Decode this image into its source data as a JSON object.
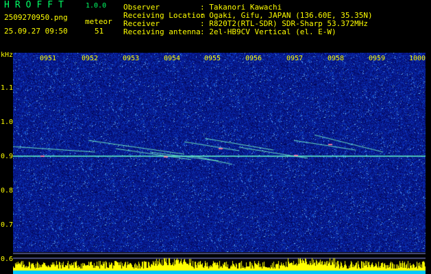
{
  "header": {
    "app_title": "HROFFT",
    "version": "1.0.0",
    "filename": "2509270950.png",
    "datetime": "25.09.27 09:50",
    "type_label": "meteor",
    "type_count": "51",
    "info": [
      {
        "key": "Observer",
        "value": ": Takanori Kawachi"
      },
      {
        "key": "Receiving Location",
        "value": ": Ogaki, Gifu, JAPAN (136.60E, 35.35N)"
      },
      {
        "key": "Receiver",
        "value": ": R820T2(RTL-SDR) SDR-Sharp 53.372MHz"
      },
      {
        "key": "Receiving antenna",
        "value": ": 2el-HB9CV Vertical (el. E-W)"
      }
    ]
  },
  "axes": {
    "y_unit": "kHz",
    "y_ticks": [
      "1.1",
      "1.0",
      "0.9",
      "0.8",
      "0.7",
      "0.6"
    ],
    "x_ticks": [
      "0951",
      "0952",
      "0953",
      "0954",
      "0955",
      "0956",
      "0957",
      "0958",
      "0959",
      "1000"
    ]
  },
  "colors": {
    "background": "#000000",
    "noise_floor": "#0a1a8c",
    "label_yellow": "#ffff00",
    "title_green": "#00ff66",
    "carrier_cyan": "#66ffcc",
    "bottom_cyan": "#00c8ff"
  }
}
